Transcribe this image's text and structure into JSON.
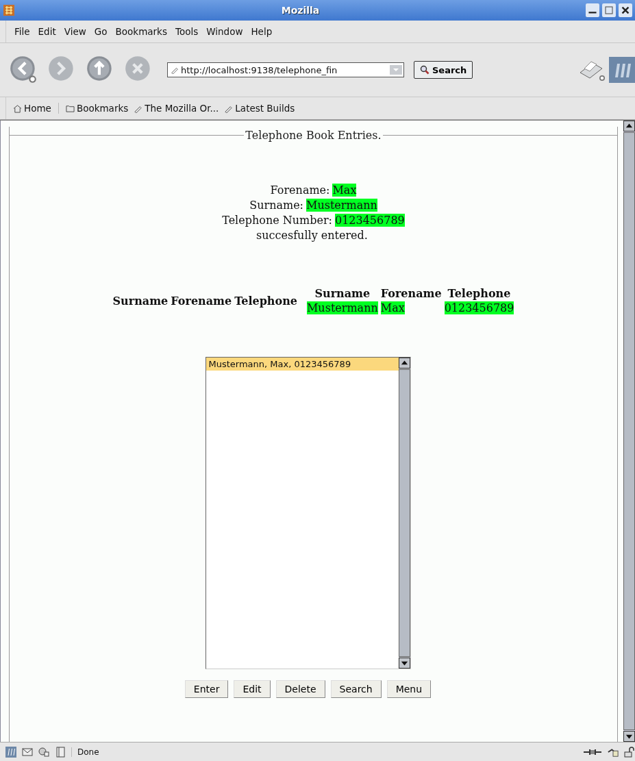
{
  "window": {
    "title": "Mozilla"
  },
  "menu": [
    "File",
    "Edit",
    "View",
    "Go",
    "Bookmarks",
    "Tools",
    "Window",
    "Help"
  ],
  "navigation": {
    "address": "http://localhost:9138/telephone_fin",
    "search_button": "Search"
  },
  "bookmarks": [
    "Home",
    "Bookmarks",
    "The Mozilla Or...",
    "Latest Builds"
  ],
  "page": {
    "legend": "Telephone Book Entries.",
    "message": [
      {
        "label": "Forename:",
        "value": "Max"
      },
      {
        "label": "Surname:",
        "value": "Mustermann"
      },
      {
        "label": "Telephone Number:",
        "value": "0123456789"
      }
    ],
    "message_end": "succesfully entered.",
    "empty_table": {
      "columns": [
        "Surname",
        "Forename",
        "Telephone"
      ]
    },
    "result_table": {
      "columns": [
        "Surname",
        "Forename",
        "Telephone"
      ],
      "rows": [
        [
          "Mustermann",
          "Max",
          "0123456789"
        ]
      ]
    },
    "entries": [
      {
        "text": "Mustermann, Max, 0123456789",
        "selected": true
      }
    ],
    "buttons": [
      "Enter",
      "Edit",
      "Delete",
      "Search",
      "Menu"
    ]
  },
  "status_bar": {
    "text": "Done"
  }
}
